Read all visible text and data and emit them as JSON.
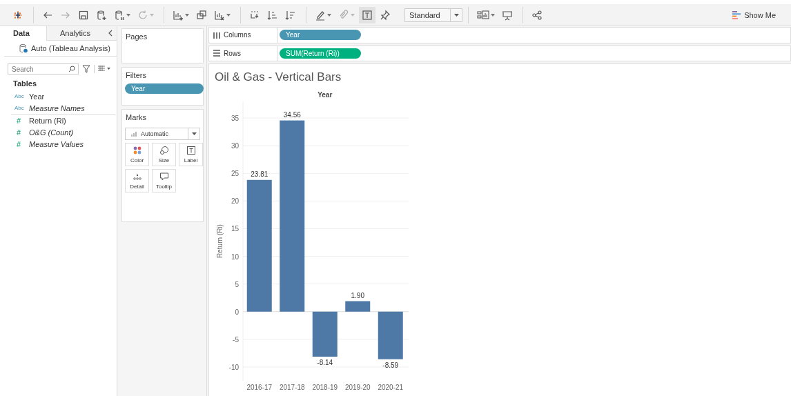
{
  "toolbar": {
    "mark_size_dropdown": "Standard",
    "show_me": "Show Me"
  },
  "side_tabs": [
    {
      "label": "Data",
      "selected": true
    },
    {
      "label": "Analytics",
      "selected": false
    }
  ],
  "data_source": "Auto (Tableau Analysis)",
  "search": {
    "placeholder": "Search"
  },
  "tables_heading": "Tables",
  "fields": [
    {
      "kind": "dimension",
      "badge": "Abc",
      "name": "Year",
      "generated": false
    },
    {
      "kind": "dimension",
      "badge": "Abc",
      "name": "Measure Names",
      "generated": true
    },
    {
      "kind": "measure",
      "badge": "#",
      "name": "Return (Ri)",
      "generated": false
    },
    {
      "kind": "measure",
      "badge": "#",
      "name": "O&G (Count)",
      "generated": true
    },
    {
      "kind": "measure",
      "badge": "#",
      "name": "Measure Values",
      "generated": true
    }
  ],
  "pages": {
    "title": "Pages"
  },
  "filters": {
    "title": "Filters",
    "pills": [
      {
        "label": "Year",
        "kind": "dimension"
      }
    ]
  },
  "marks": {
    "title": "Marks",
    "type": "Automatic",
    "buttons": [
      {
        "kind": "color",
        "label": "Color"
      },
      {
        "kind": "size",
        "label": "Size"
      },
      {
        "kind": "label",
        "label": "Label"
      },
      {
        "kind": "detail",
        "label": "Detail"
      },
      {
        "kind": "tooltip",
        "label": "Tooltip"
      }
    ]
  },
  "shelves": [
    {
      "kind": "columns",
      "label": "Columns",
      "pill": {
        "label": "Year",
        "kind": "dimension"
      }
    },
    {
      "kind": "rows",
      "label": "Rows",
      "pill": {
        "label": "SUM(Return (Ri))",
        "kind": "measure"
      }
    }
  ],
  "chart_data": {
    "type": "bar",
    "title": "Oil & Gas - Vertical Bars",
    "xlabel": "Year",
    "ylabel": "Return (Ri)",
    "categories": [
      "2016-17",
      "2017-18",
      "2018-19",
      "2019-20",
      "2020-21"
    ],
    "series": [
      {
        "color": "#4e79a7",
        "values": [
          23.81,
          34.56,
          -8.14,
          1.9,
          -8.59
        ]
      }
    ],
    "grid": true,
    "value_labels": [
      "23.81",
      "34.56",
      "-8.14",
      "1.90",
      "-8.59"
    ],
    "ylim": [
      -12.5,
      38
    ],
    "yticks": [
      -10,
      -5,
      0,
      5,
      10,
      15,
      20,
      25,
      30,
      35
    ]
  }
}
